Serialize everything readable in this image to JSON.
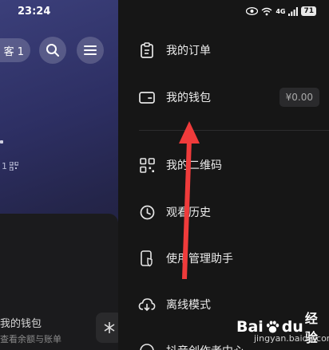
{
  "status_bar": {
    "time": "23:24",
    "network": "4G",
    "battery": "71"
  },
  "background_page": {
    "visitor_label": "客 1",
    "side_number": "1",
    "wallet_title": "我的钱包",
    "wallet_subtitle": "查看余额与账单"
  },
  "drawer": {
    "items": [
      {
        "label": "我的订单",
        "icon": "clipboard-icon"
      },
      {
        "label": "我的钱包",
        "icon": "wallet-icon",
        "badge": "¥0.00"
      },
      {
        "label": "我的二维码",
        "icon": "qr-code-icon"
      },
      {
        "label": "观看历史",
        "icon": "clock-icon"
      },
      {
        "label": "使用管理助手",
        "icon": "phone-shield-icon"
      },
      {
        "label": "离线模式",
        "icon": "cloud-download-icon"
      },
      {
        "label": "抖音创作者中心",
        "icon": "creator-icon"
      }
    ]
  },
  "annotation": {
    "color": "#ef3b3b"
  },
  "watermark": {
    "brand": "Bai",
    "brand_suffix": "du",
    "text": "经验",
    "url": "jingyan.baidu.com"
  }
}
